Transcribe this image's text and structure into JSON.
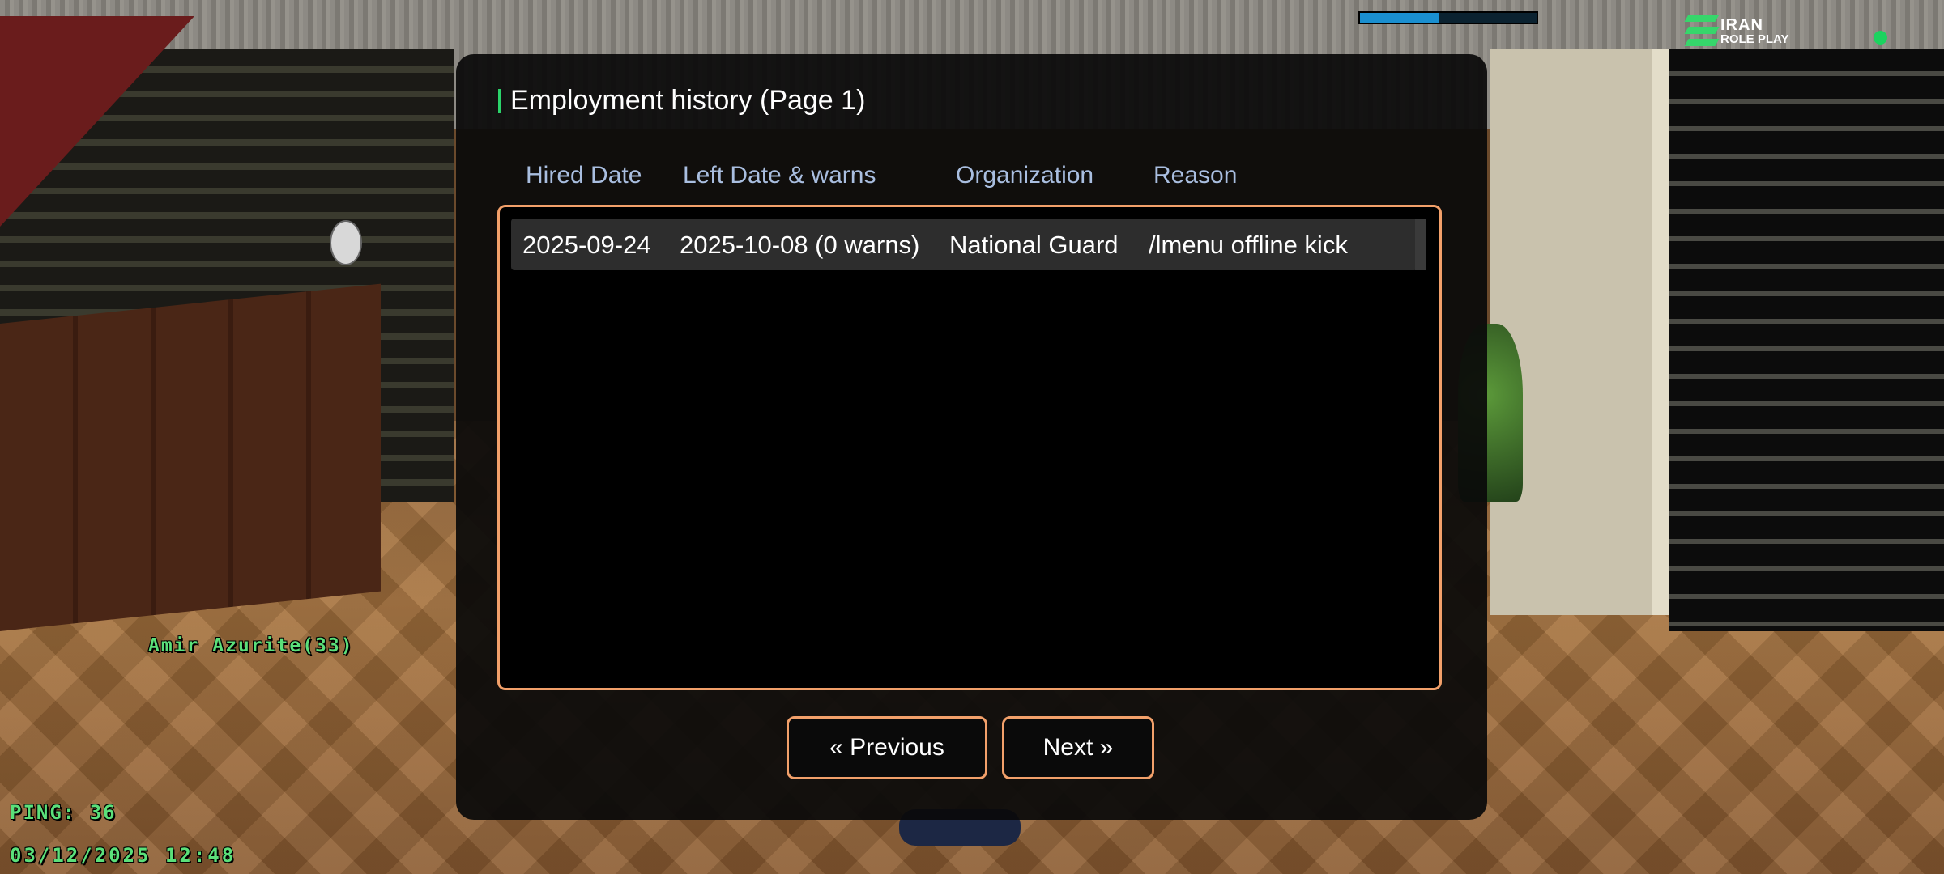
{
  "hud": {
    "logo_title": "IRAN",
    "logo_subtitle": "ROLE PLAY",
    "progress": 0.45,
    "player_name": "Amir Azurite(33)",
    "ping": "PING: 36",
    "datetime": "03/12/2025 12:48",
    "status_color": "#1bd35f"
  },
  "dialog": {
    "title": "Employment history (Page 1)",
    "columns": [
      "Hired Date",
      "Left Date & warns",
      "Organization",
      "Reason"
    ],
    "rows": [
      [
        "2025-09-24",
        "2025-10-08 (0 warns)",
        "National Guard",
        "/lmenu offline kick"
      ]
    ],
    "prev_label": "« Previous",
    "next_label": "Next »",
    "accent_color": "#f2a06a",
    "header_color": "#a9bee0"
  }
}
